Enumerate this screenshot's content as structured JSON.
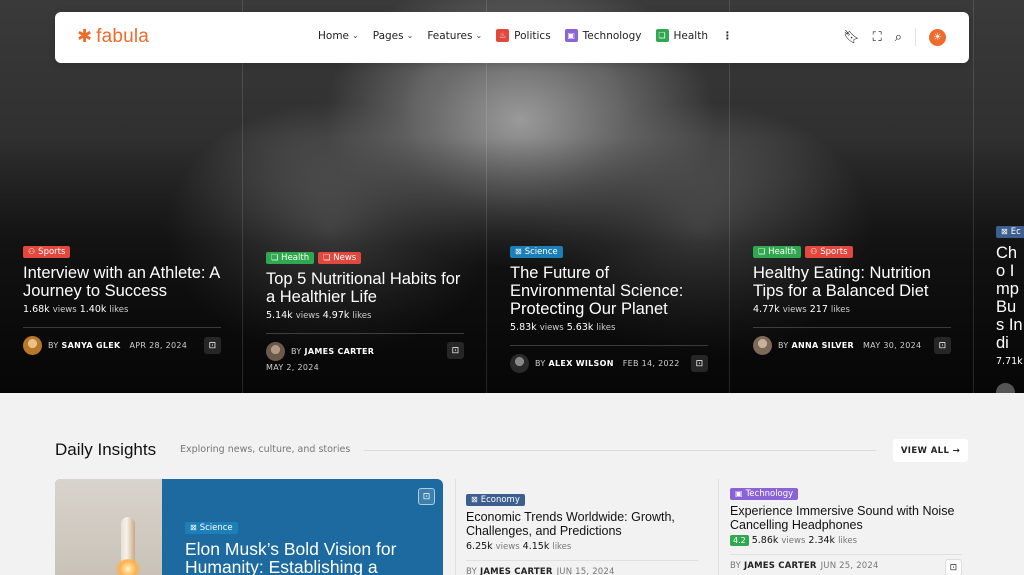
{
  "brand": {
    "name": "fabula",
    "mark": "✱"
  },
  "nav": {
    "items": [
      {
        "label": "Home",
        "dropdown": true
      },
      {
        "label": "Pages",
        "dropdown": true
      },
      {
        "label": "Features",
        "dropdown": true
      }
    ],
    "categories": [
      {
        "label": "Politics",
        "color": "#e2483d",
        "icon": "flame-icon"
      },
      {
        "label": "Technology",
        "color": "#8b63d8",
        "icon": "chip-icon"
      },
      {
        "label": "Health",
        "color": "#2fa84f",
        "icon": "leaf-icon"
      }
    ],
    "more": "⋮"
  },
  "hero": [
    {
      "tags": [
        {
          "label": "Sports",
          "color": "#e2483d"
        }
      ],
      "title": "Interview with an Athlete: A Journey to Success",
      "views": "1.68k",
      "views_label": "views",
      "likes": "1.40k",
      "likes_label": "likes",
      "by": "BY",
      "author": "SANYA GLEK",
      "date": "APR 28, 2024",
      "avatar": "#b8782a"
    },
    {
      "tags": [
        {
          "label": "Health",
          "color": "#2fa84f"
        },
        {
          "label": "News",
          "color": "#e2483d"
        }
      ],
      "title": "Top 5 Nutritional Habits for a Healthier Life",
      "views": "5.14k",
      "views_label": "views",
      "likes": "4.97k",
      "likes_label": "likes",
      "by": "BY",
      "author": "JAMES CARTER",
      "date": "MAY 2, 2024",
      "avatar": "#6b5a4c"
    },
    {
      "tags": [
        {
          "label": "Science",
          "color": "#1c7fb8"
        }
      ],
      "title": "The Future of Environmental Science: Protecting Our Planet",
      "views": "5.83k",
      "views_label": "views",
      "likes": "5.63k",
      "likes_label": "likes",
      "by": "BY",
      "author": "ALEX WILSON",
      "date": "FEB 14, 2022",
      "avatar": "#3a3a3a"
    },
    {
      "tags": [
        {
          "label": "Health",
          "color": "#2fa84f"
        },
        {
          "label": "Sports",
          "color": "#e2483d"
        }
      ],
      "title": "Healthy Eating: Nutrition Tips for a Balanced Diet",
      "views": "4.77k",
      "views_label": "views",
      "likes": "217",
      "likes_label": "likes",
      "by": "BY",
      "author": "ANNA SILVER",
      "date": "MAY 30, 2024",
      "avatar": "#7d6a58"
    },
    {
      "tags": [
        {
          "label": "Ec",
          "color": "#3d5f8f"
        }
      ],
      "title": "Cho Imp Bus Indi",
      "views": "7.71k",
      "views_label": "",
      "likes": "",
      "likes_label": "",
      "by": "",
      "author": "",
      "date": "",
      "avatar": "#444"
    }
  ],
  "section": {
    "title": "Daily Insights",
    "subtitle": "Exploring news, culture, and stories",
    "view_all": "VIEW ALL →"
  },
  "feature": {
    "tag": {
      "label": "Science",
      "color": "#1c7fb8"
    },
    "title": "Elon Musk’s Bold Vision for Humanity: Establishing a"
  },
  "articles": [
    {
      "tag": {
        "label": "Economy",
        "color": "#3d5f8f"
      },
      "title": "Economic Trends Worldwide: Growth, Challenges, and Predictions",
      "views": "6.25k",
      "views_label": "views",
      "likes": "4.15k",
      "likes_label": "likes",
      "rating": "",
      "by": "BY",
      "author": "JAMES CARTER",
      "date": "JUN 15, 2024"
    },
    {
      "tag": {
        "label": "Technology",
        "color": "#8b63d8"
      },
      "title": "Experience Immersive Sound with Noise Cancelling Headphones",
      "views": "5.86k",
      "views_label": "views",
      "likes": "2.34k",
      "likes_label": "likes",
      "rating": "4.2",
      "by": "BY",
      "author": "JAMES CARTER",
      "date": "JUN 25, 2024"
    }
  ]
}
